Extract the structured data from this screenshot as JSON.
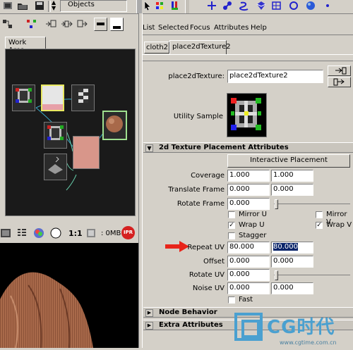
{
  "toolbar": {
    "selection_mode_label": "Objects",
    "icons_left": [
      "render-icon",
      "folder-open-icon",
      "save-icon"
    ],
    "icons_right": [
      "select-arrow-icon",
      "paint-select-icon",
      "move-icon",
      "lasso-icon",
      "magnet-icon",
      "curve-icon",
      "cube-icon",
      "grid-icon",
      "sphere-icon",
      "dot-icon"
    ]
  },
  "hypershade": {
    "tab_label": "Work Area",
    "icons": [
      "graph-icon",
      "network-icon",
      "input-connections-icon",
      "io-connections-icon",
      "output-connections-icon",
      "layout-a-icon",
      "layout-b-icon"
    ]
  },
  "render_view": {
    "ratio_label": "1:1",
    "memory_label": ": 0MB",
    "ipr_label": "IPR"
  },
  "attribute_editor": {
    "menus": [
      "List",
      "Selected",
      "Focus",
      "Attributes",
      "Help"
    ],
    "tabs": [
      "cloth2",
      "place2dTexture2"
    ],
    "node_type_label": "place2dTexture:",
    "node_name": "place2dTexture2",
    "utility_sample_label": "Utility Sample",
    "sections": {
      "placement": "2d Texture Placement Attributes",
      "node_behavior": "Node Behavior",
      "extra": "Extra Attributes"
    },
    "interactive_placement_label": "Interactive Placement",
    "rows": {
      "coverage": {
        "label": "Coverage",
        "u": "1.000",
        "v": "1.000"
      },
      "translate_frame": {
        "label": "Translate Frame",
        "u": "0.000",
        "v": "0.000"
      },
      "rotate_frame": {
        "label": "Rotate Frame",
        "value": "0.000"
      },
      "repeat_uv": {
        "label": "Repeat UV",
        "u": "80.000",
        "v": "80.000"
      },
      "offset": {
        "label": "Offset",
        "u": "0.000",
        "v": "0.000"
      },
      "rotate_uv": {
        "label": "Rotate UV",
        "value": "0.000"
      },
      "noise_uv": {
        "label": "Noise UV",
        "u": "0.000",
        "v": "0.000"
      }
    },
    "checkboxes": {
      "mirror_u": {
        "label": "Mirror U",
        "checked": false
      },
      "mirror_v": {
        "label": "Mirror V",
        "checked": false
      },
      "wrap_u": {
        "label": "Wrap U",
        "checked": true
      },
      "wrap_v": {
        "label": "Wrap V",
        "checked": true
      },
      "stagger": {
        "label": "Stagger",
        "checked": false
      },
      "fast": {
        "label": "Fast",
        "checked": false
      }
    }
  },
  "watermark": {
    "brand": "CG时代",
    "url": "www.cgtime.com.cn"
  },
  "colors": {
    "accent_arrow": "#e8241a",
    "selection_highlight": "#0a246a",
    "cloth_brown": "#a8694a"
  }
}
